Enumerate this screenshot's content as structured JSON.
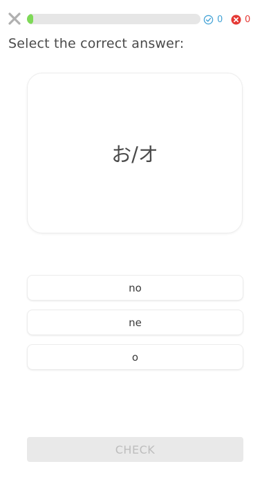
{
  "header": {
    "progress_fraction": 0.03,
    "correct_count": "0",
    "wrong_count": "0",
    "colors": {
      "progress": "#7ed957",
      "correct": "#44a3d6",
      "wrong": "#e53935"
    },
    "icons": {
      "close": "close-icon",
      "correct": "check-circle-icon",
      "wrong": "x-circle-icon"
    }
  },
  "question": {
    "prompt": "Select the correct answer:",
    "kana": "お/オ"
  },
  "options": [
    {
      "label": "no"
    },
    {
      "label": "ne"
    },
    {
      "label": "o"
    }
  ],
  "footer": {
    "check_label": "CHECK"
  }
}
